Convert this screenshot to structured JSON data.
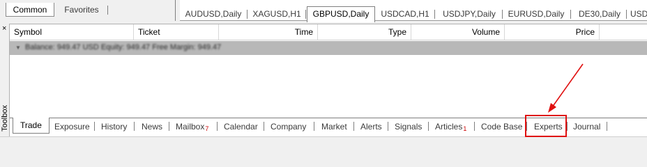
{
  "navigator": {
    "tabs": [
      "Common",
      "Favorites"
    ]
  },
  "chart_tabs": [
    "AUDUSD,Daily",
    "XAGUSD,H1",
    "GBPUSD,Daily",
    "USDCAD,H1",
    "USDJPY,Daily",
    "EURUSD,Daily",
    "DE30,Daily",
    "USD"
  ],
  "active_chart_tab": "GBPUSD,Daily",
  "toolbox": {
    "side_label": "Toolbox",
    "close_glyph": "×",
    "columns": [
      "Symbol",
      "Ticket",
      "Time",
      "Type",
      "Volume",
      "Price"
    ],
    "balance_line": "Balance: 949.47 USD  Equity: 949.47  Free Margin: 949.47",
    "tabs": [
      {
        "label": "Trade",
        "badge": ""
      },
      {
        "label": "Exposure",
        "badge": ""
      },
      {
        "label": "History",
        "badge": ""
      },
      {
        "label": "News",
        "badge": ""
      },
      {
        "label": "Mailbox",
        "badge": "7"
      },
      {
        "label": "Calendar",
        "badge": ""
      },
      {
        "label": "Company",
        "badge": ""
      },
      {
        "label": "Market",
        "badge": ""
      },
      {
        "label": "Alerts",
        "badge": ""
      },
      {
        "label": "Signals",
        "badge": ""
      },
      {
        "label": "Articles",
        "badge": "1"
      },
      {
        "label": "Code Base",
        "badge": ""
      },
      {
        "label": "Experts",
        "badge": ""
      },
      {
        "label": "Journal",
        "badge": ""
      }
    ],
    "active_tab": "Trade",
    "highlighted_tab": "Experts"
  },
  "colors": {
    "annotation": "#e01010",
    "badge": "#cc0000",
    "balance_row": "#b8b8b8"
  }
}
